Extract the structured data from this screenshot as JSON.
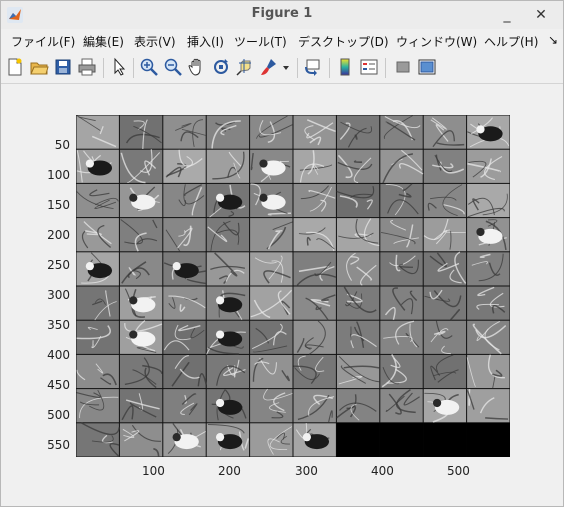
{
  "window": {
    "title": "Figure 1",
    "minimize_glyph": "_",
    "close_glyph": "✕"
  },
  "menu": {
    "items": [
      "ファイル(F)",
      "編集(E)",
      "表示(V)",
      "挿入(I)",
      "ツール(T)",
      "デスクトップ(D)",
      "ウィンドウ(W)",
      "ヘルプ(H)"
    ],
    "overflow_glyph": "↘"
  },
  "toolbar": {
    "icons": [
      "new-figure-icon",
      "open-file-icon",
      "save-icon",
      "print-icon",
      "select-arrow-icon",
      "zoom-in-icon",
      "zoom-out-icon",
      "pan-hand-icon",
      "rotate-3d-icon",
      "data-cursor-icon",
      "brush-icon",
      "brush-dropdown-icon",
      "link-plot-icon",
      "colorbar-icon",
      "legend-icon",
      "hide-plot-tools-icon",
      "show-plot-tools-icon"
    ]
  },
  "axes": {
    "y_ticks": [
      "50",
      "100",
      "150",
      "200",
      "250",
      "300",
      "350",
      "400",
      "450",
      "500",
      "550"
    ],
    "x_ticks": [
      "100",
      "200",
      "300",
      "400",
      "500"
    ]
  },
  "montage": {
    "rows": 10,
    "cols": 10,
    "filled_tiles": 96,
    "empty_color": "#000000",
    "bird_tiles": [
      9,
      10,
      14,
      21,
      23,
      24,
      39,
      40,
      42,
      51,
      53,
      61,
      63,
      83,
      88,
      93,
      95,
      92
    ]
  }
}
